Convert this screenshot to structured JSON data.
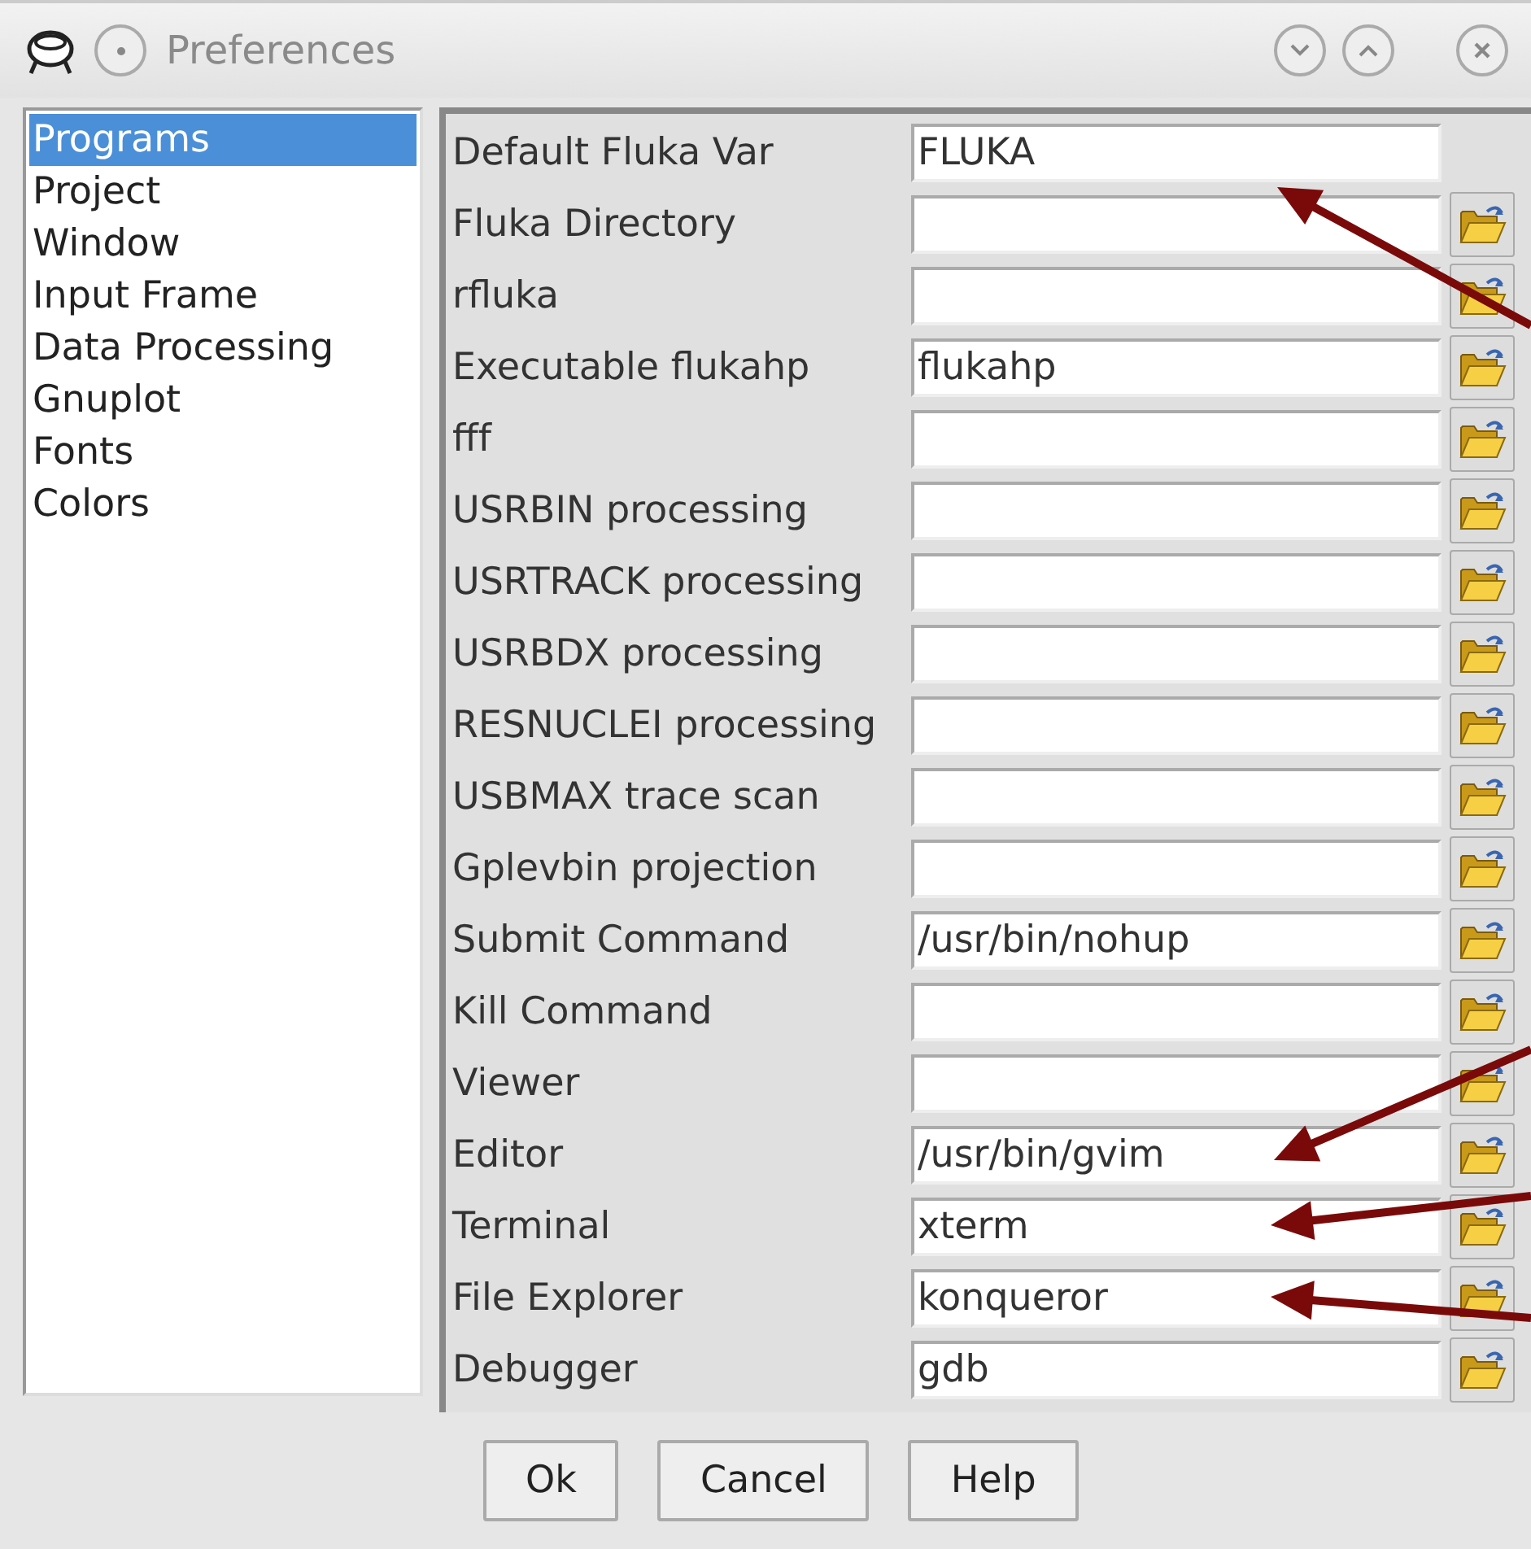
{
  "window": {
    "title": "Preferences"
  },
  "sidebar": {
    "items": [
      {
        "label": "Programs",
        "selected": true
      },
      {
        "label": "Project",
        "selected": false
      },
      {
        "label": "Window",
        "selected": false
      },
      {
        "label": "Input Frame",
        "selected": false
      },
      {
        "label": "Data Processing",
        "selected": false
      },
      {
        "label": "Gnuplot",
        "selected": false
      },
      {
        "label": "Fonts",
        "selected": false
      },
      {
        "label": "Colors",
        "selected": false
      }
    ]
  },
  "settings": [
    {
      "label": "Default Fluka Var",
      "value": "FLUKA",
      "browse": false
    },
    {
      "label": "Fluka Directory",
      "browse": true
    },
    {
      "label": "rfluka",
      "browse": true
    },
    {
      "label": "Executable flukahp",
      "value": "flukahp",
      "browse": true
    },
    {
      "label": "fff",
      "browse": true
    },
    {
      "label": "USRBIN processing",
      "browse": true
    },
    {
      "label": "USRTRACK processing",
      "browse": true
    },
    {
      "label": "USRBDX processing",
      "browse": true
    },
    {
      "label": "RESNUCLEI processing",
      "browse": true
    },
    {
      "label": "USBMAX trace scan",
      "browse": true
    },
    {
      "label": "Gplevbin projection",
      "browse": true
    },
    {
      "label": "Submit Command",
      "value": "/usr/bin/nohup",
      "browse": true
    },
    {
      "label": "Kill Command",
      "browse": true
    },
    {
      "label": "Viewer",
      "browse": true
    },
    {
      "label": "Editor",
      "value": "/usr/bin/gvim",
      "browse": true
    },
    {
      "label": "Terminal",
      "value": "xterm",
      "browse": true
    },
    {
      "label": "File Explorer",
      "value": "konqueror",
      "browse": true
    },
    {
      "label": "Debugger",
      "value": "gdb",
      "browse": true
    }
  ],
  "buttons": [
    "Ok",
    "Cancel",
    "Help"
  ]
}
